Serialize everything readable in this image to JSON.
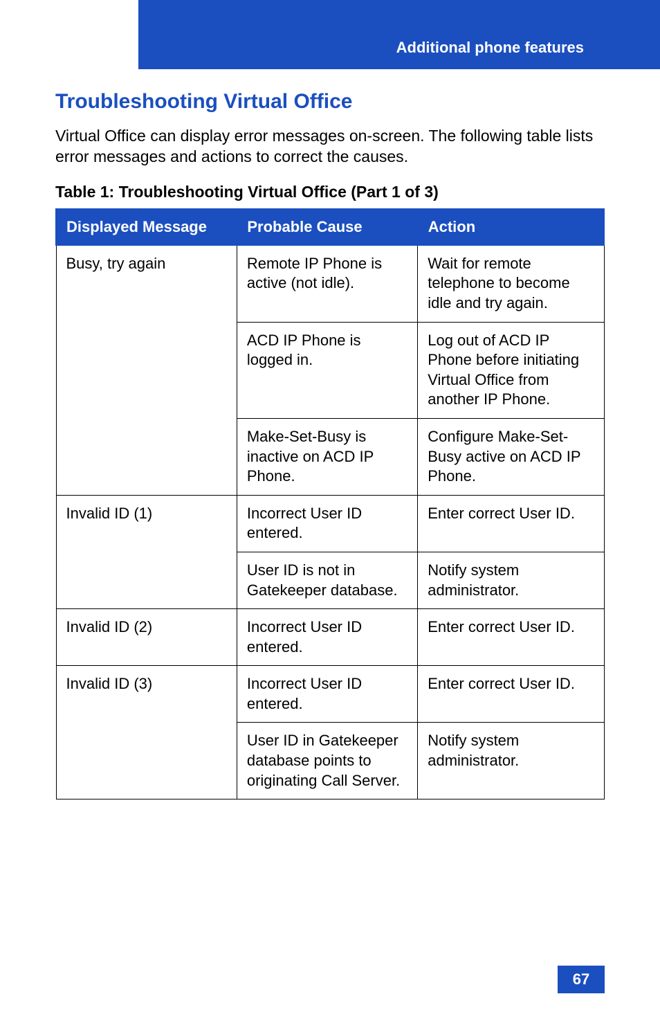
{
  "header": {
    "section_title": "Additional phone features"
  },
  "page": {
    "heading": "Troubleshooting Virtual Office",
    "intro": "Virtual Office can display error messages on-screen. The following table lists error messages and actions to correct the causes.",
    "table_title": "Table 1: Troubleshooting Virtual Office (Part 1 of 3)"
  },
  "table": {
    "headers": {
      "col1": "Displayed Message",
      "col2": "Probable Cause",
      "col3": "Action"
    },
    "rows": [
      {
        "message": "Busy, try again",
        "rowspan": 3,
        "cause": "Remote IP Phone is active (not idle).",
        "action": "Wait for remote telephone to become idle and try again."
      },
      {
        "cause": "ACD IP Phone is logged in.",
        "action": "Log out of ACD IP Phone before initiating Virtual Office from another IP Phone."
      },
      {
        "cause": "Make-Set-Busy is inactive on ACD IP Phone.",
        "action": "Configure Make-Set-Busy active on ACD IP Phone."
      },
      {
        "message": "Invalid ID (1)",
        "rowspan": 2,
        "cause": "Incorrect User ID entered.",
        "action": "Enter correct User ID."
      },
      {
        "cause": "User ID is not in Gatekeeper database.",
        "action": "Notify system administrator."
      },
      {
        "message": "Invalid ID (2)",
        "rowspan": 1,
        "cause": "Incorrect User ID entered.",
        "action": "Enter correct User ID."
      },
      {
        "message": "Invalid ID (3)",
        "rowspan": 2,
        "cause": "Incorrect User ID entered.",
        "action": "Enter correct User ID."
      },
      {
        "cause": "User ID in Gatekeeper database points to originating Call Server.",
        "action": "Notify system administrator."
      }
    ]
  },
  "footer": {
    "page_number": "67"
  }
}
